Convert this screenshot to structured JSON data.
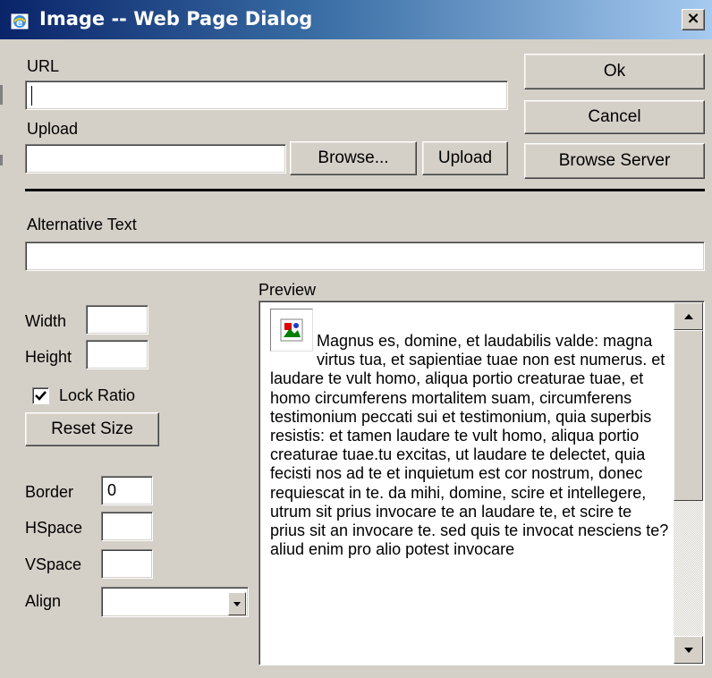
{
  "window": {
    "title": "Image -- Web Page Dialog",
    "close_label": "×"
  },
  "url": {
    "label": "URL",
    "value": ""
  },
  "upload": {
    "label": "Upload",
    "value": "",
    "browse_label": "Browse...",
    "upload_label": "Upload"
  },
  "actions": {
    "ok_label": "Ok",
    "cancel_label": "Cancel",
    "browse_server_label": "Browse Server"
  },
  "alt_text": {
    "label": "Alternative Text",
    "value": ""
  },
  "size": {
    "width_label": "Width",
    "width_value": "",
    "height_label": "Height",
    "height_value": "",
    "lock_ratio_label": "Lock Ratio",
    "lock_ratio_checked": true,
    "reset_size_label": "Reset Size"
  },
  "layout": {
    "border_label": "Border",
    "border_value": "0",
    "hspace_label": "HSpace",
    "hspace_value": "",
    "vspace_label": "VSpace",
    "vspace_value": "",
    "align_label": "Align",
    "align_value": ""
  },
  "preview": {
    "label": "Preview",
    "text": "Magnus es, domine, et laudabilis valde: magna virtus tua, et sapientiae tuae non est numerus. et laudare te vult homo, aliqua portio creaturae tuae, et homo circumferens mortalitem suam, circumferens testimonium peccati sui et testimonium, quia superbis resistis: et tamen laudare te vult homo, aliqua portio creaturae tuae.tu excitas, ut laudare te delectet, quia fecisti nos ad te et inquietum est cor nostrum, donec requiescat in te. da mihi, domine, scire et intellegere, utrum sit prius invocare te an laudare te, et scire te prius sit an invocare te. sed quis te invocat nesciens te? aliud enim pro alio potest invocare"
  },
  "icons": {
    "title": "ie-window-icon",
    "preview_image": "broken-image-icon",
    "scroll_up": "scroll-up-arrow-icon",
    "scroll_down": "scroll-down-arrow-icon",
    "dropdown": "chevron-down-icon",
    "checkmark": "checkmark-icon"
  },
  "colors": {
    "face": "#d4d0c8",
    "title_start": "#0a246a",
    "title_end": "#a6caf0"
  }
}
